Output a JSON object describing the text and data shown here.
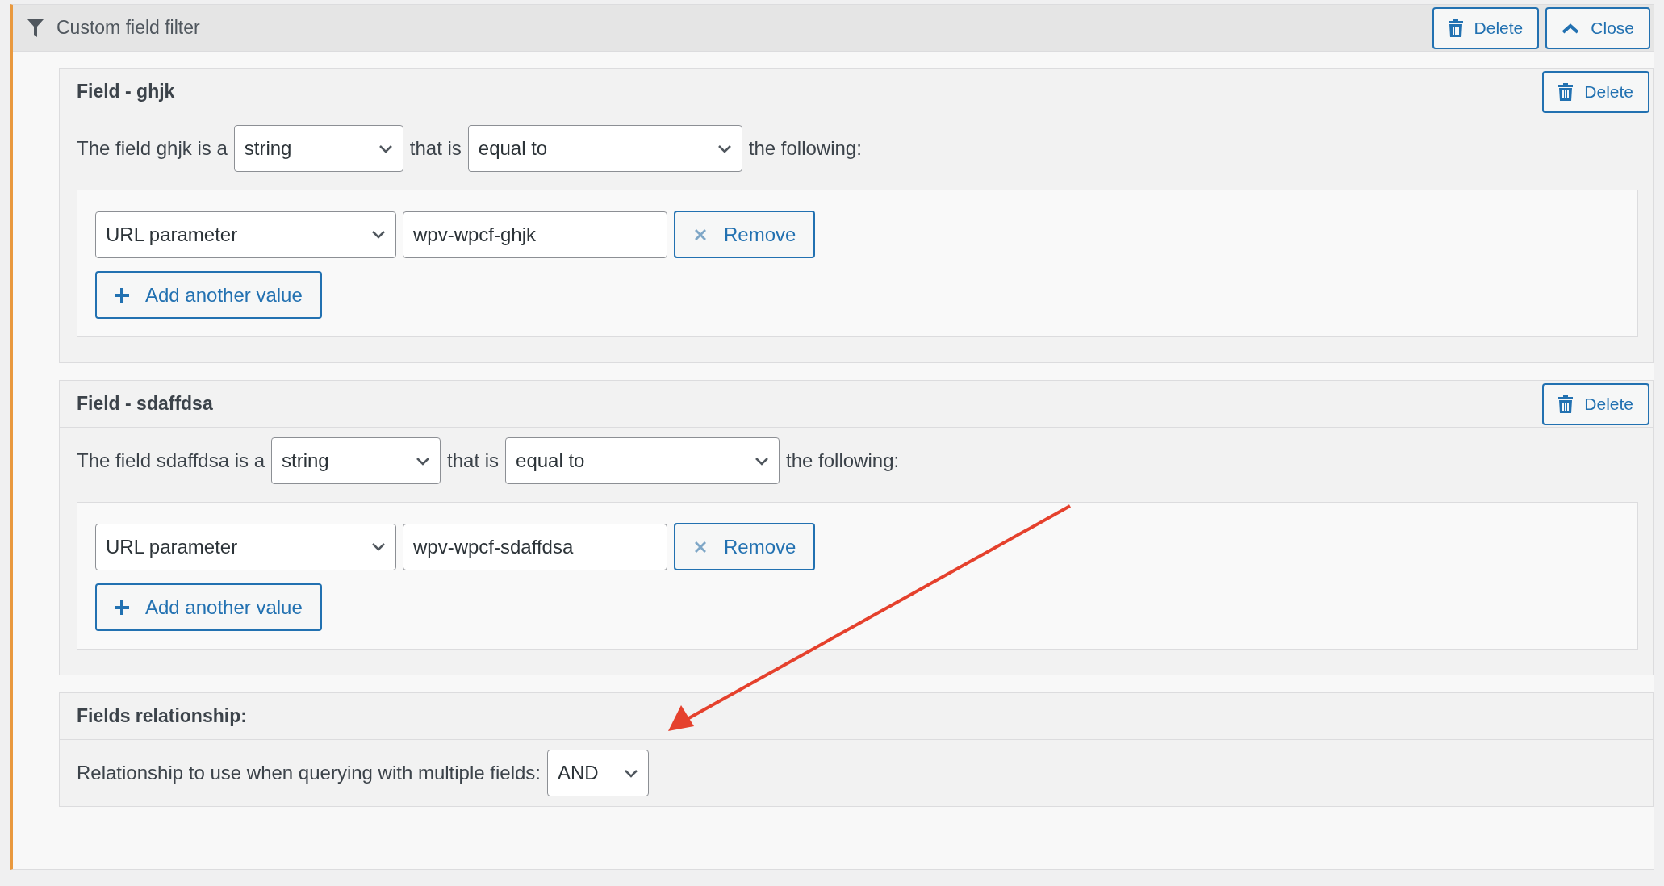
{
  "panel": {
    "title": "Custom field filter",
    "buttons": [
      {
        "label": "Delete",
        "kind": "delete"
      },
      {
        "label": "Close",
        "kind": "close"
      }
    ]
  },
  "fields": [
    {
      "title": "Field - ghjk",
      "delete_button": "Delete",
      "prefix": "The field ghjk is a",
      "type": "string",
      "connector": "that is",
      "comparison": "equal to",
      "suffix": "the following:",
      "values": [
        {
          "source": "URL parameter",
          "value": "wpv-wpcf-ghjk",
          "remove_button": "Remove"
        }
      ],
      "add_button": "Add another value"
    },
    {
      "title": "Field - sdaffdsa",
      "delete_button": "Delete",
      "prefix": "The field sdaffdsa is a",
      "type": "string",
      "connector": "that is",
      "comparison": "equal to",
      "suffix": "the following:",
      "values": [
        {
          "source": "URL parameter",
          "value": "wpv-wpcf-sdaffdsa",
          "remove_button": "Remove"
        }
      ],
      "add_button": "Add another value"
    }
  ],
  "relationship": {
    "title": "Fields relationship:",
    "label": "Relationship to use when querying with multiple fields:",
    "value": "AND"
  }
}
